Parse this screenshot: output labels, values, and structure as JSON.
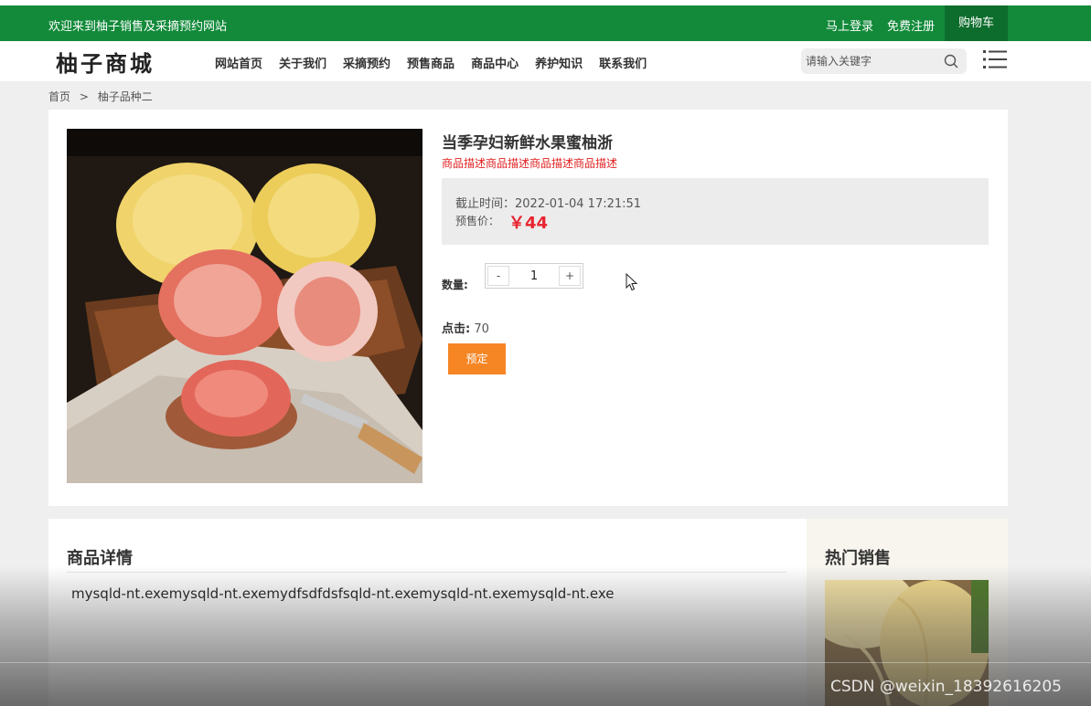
{
  "topbar": {
    "welcome": "欢迎来到柚子销售及采摘预约网站",
    "login": "马上登录",
    "register": "免费注册",
    "cart": "购物车"
  },
  "header": {
    "logo": "柚子商城",
    "nav": [
      "网站首页",
      "关于我们",
      "采摘预约",
      "预售商品",
      "商品中心",
      "养护知识",
      "联系我们"
    ],
    "search_placeholder": "请输入关键字"
  },
  "breadcrumb": {
    "home": "首页",
    "separator": ">",
    "current": "柚子品种二"
  },
  "product": {
    "title": "当季孕妇新鲜水果蜜柚浙",
    "description": "商品描述商品描述商品描述商品描述",
    "deadline": "截止时间：2022-01-04 17:21:51",
    "presale_label": "预售价：",
    "price": "￥44",
    "quantity_label": "数量:",
    "quantity": "1",
    "minus": "-",
    "plus": "+",
    "clicks_label": "点击:",
    "clicks": "70",
    "book_button": "预定"
  },
  "details": {
    "title": "商品详情",
    "body": "mysqld-nt.exemysqld-nt.exemydfsdfdsfsqld-nt.exemysqld-nt.exemysqld-nt.exe"
  },
  "hot": {
    "title": "热门销售"
  },
  "watermark": "CSDN @weixin_18392616205",
  "colors": {
    "brand_green": "#128a3a",
    "price_red": "#e8242f",
    "book_orange": "#f68524"
  }
}
